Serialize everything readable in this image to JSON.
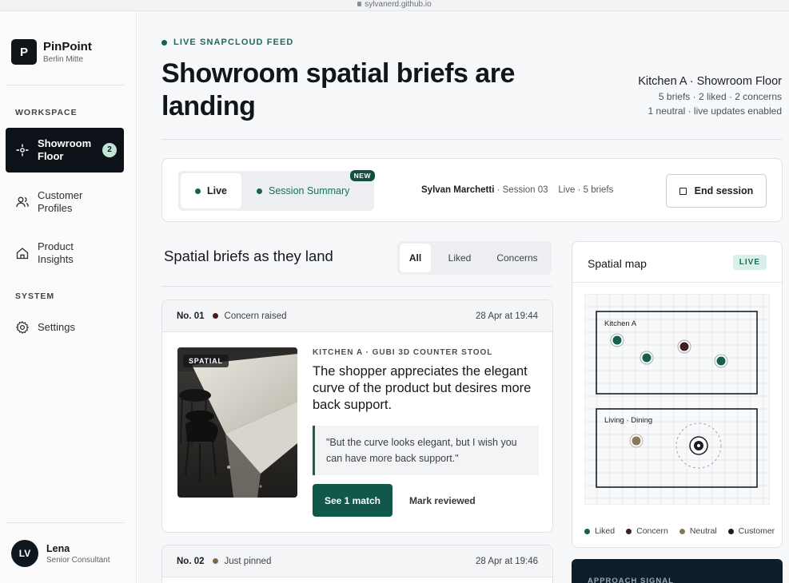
{
  "browser": {
    "url": "sylvanerd.github.io"
  },
  "brand": {
    "logo_letter": "P",
    "name": "PinPoint",
    "location": "Berlin Mitte"
  },
  "sidebar": {
    "workspace_label": "WORKSPACE",
    "system_label": "SYSTEM",
    "items": [
      {
        "label": "Showroom Floor",
        "badge": "2",
        "active": true
      },
      {
        "label": "Customer Profiles"
      },
      {
        "label": "Product Insights"
      }
    ],
    "settings_label": "Settings"
  },
  "user": {
    "initials": "LV",
    "name": "Lena",
    "role": "Senior Consultant"
  },
  "header": {
    "eyebrow": "LIVE SNAPCLOUD FEED",
    "title": "Showroom spatial briefs are landing",
    "context_title": "Kitchen A · Showroom Floor",
    "context_line1": "5 briefs · 2 liked · 2 concerns",
    "context_line2": "1 neutral · live updates enabled"
  },
  "session": {
    "tab_live": "Live",
    "tab_summary": "Session Summary",
    "new_badge": "NEW",
    "consultant": "Sylvan Marchetti",
    "session_label": "· Session 03",
    "status": "Live · 5 briefs",
    "end_button": "End session"
  },
  "feed": {
    "heading": "Spatial briefs as they land",
    "filters": [
      "All",
      "Liked",
      "Concerns"
    ],
    "active_filter": "All"
  },
  "cards": [
    {
      "number": "No. 01",
      "status": "Concern raised",
      "status_color": "#4a1c1c",
      "date": "28 Apr at 19:44",
      "photo_tag": "SPATIAL",
      "product": "KITCHEN A · GUBI 3D COUNTER STOOL",
      "insight": "The shopper appreciates the elegant curve of the product but desires more back support.",
      "quote": "\"But the curve looks elegant, but I wish you can have more back support.\"",
      "primary_action": "See 1 match",
      "secondary_action": "Mark reviewed"
    },
    {
      "number": "No. 02",
      "status": "Just pinned",
      "status_color": "#7a6a4a",
      "date": "28 Apr at 19:46"
    }
  ],
  "map": {
    "title": "Spatial map",
    "badge": "LIVE",
    "zones": [
      "Kitchen A",
      "Living · Dining"
    ],
    "legend": [
      "Liked",
      "Concern",
      "Neutral",
      "Customer"
    ],
    "colors": {
      "liked": "#17604d",
      "concern": "#3d1f22",
      "neutral": "#8a7a5c",
      "customer": "#1a1d21"
    }
  },
  "signal_card": {
    "title": "APPROACH SIGNAL"
  }
}
